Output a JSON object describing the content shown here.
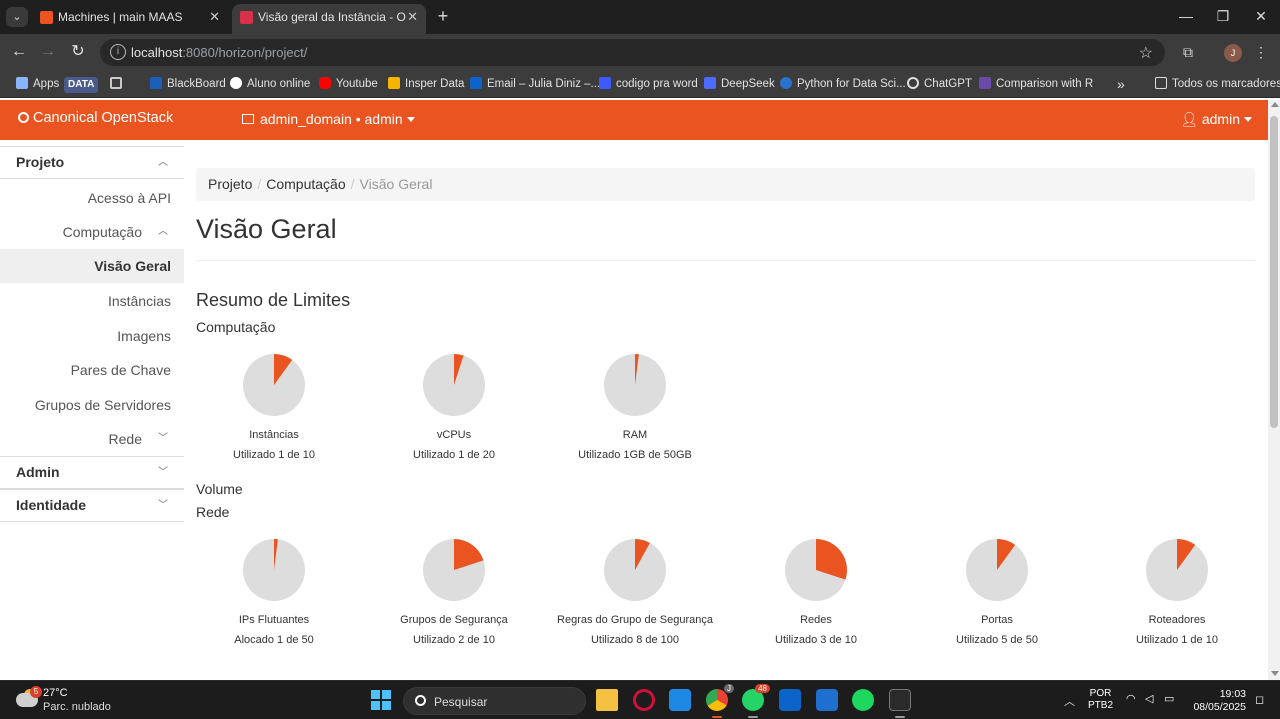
{
  "browser": {
    "tabs": [
      {
        "title": "Machines | main MAAS",
        "icon_color": "#e95420",
        "active": false
      },
      {
        "title": "Visão geral da Instância - Open",
        "icon_color": "#d9304a",
        "active": true
      }
    ],
    "url": {
      "host": "localhost",
      "path": ":8080/horizon/project/"
    },
    "bookmarks": [
      {
        "label": "Apps",
        "icon": "apps-grid-icon",
        "color": "#8ab4f8"
      },
      {
        "label": "DATA",
        "icon": "data-chip-icon",
        "color": "#4a5a8a"
      },
      {
        "label": "",
        "icon": "grid-icon",
        "color": "#cccccc"
      },
      {
        "label": "BlackBoard",
        "icon": "blackboard-icon",
        "color": "#1c5fb8"
      },
      {
        "label": "Aluno online",
        "icon": "aluno-online-icon",
        "color": "#ffffff"
      },
      {
        "label": "Youtube",
        "icon": "youtube-icon",
        "color": "#ff0000"
      },
      {
        "label": "Insper Data",
        "icon": "drive-icon",
        "color": "#f4b400"
      },
      {
        "label": "Email – Julia Diniz –...",
        "icon": "outlook-icon",
        "color": "#0a64c9"
      },
      {
        "label": "codigo pra word",
        "icon": "docs-icon",
        "color": "#3d5afe"
      },
      {
        "label": "DeepSeek",
        "icon": "deepseek-icon",
        "color": "#4d6bfe"
      },
      {
        "label": "Python for Data Sci...",
        "icon": "coursera-icon",
        "color": "#2a73cc"
      },
      {
        "label": "ChatGPT",
        "icon": "chatgpt-icon",
        "color": "#dddddd"
      },
      {
        "label": "Comparison with R",
        "icon": "pandas-icon",
        "color": "#150458"
      }
    ],
    "bookmarks_overflow": "»",
    "all_bookmarks": "Todos os marcadores",
    "profile_initial": "J"
  },
  "header": {
    "brand": "Canonical OpenStack",
    "domain_project": "admin_domain • admin",
    "user": "admin",
    "accent_color": "#e95420"
  },
  "sidebar": {
    "groups": [
      {
        "label": "Projeto",
        "expanded": true
      },
      {
        "label": "Admin",
        "expanded": false
      },
      {
        "label": "Identidade",
        "expanded": false
      }
    ],
    "items": {
      "api_access": "Acesso à API",
      "compute": "Computação",
      "overview": "Visão Geral",
      "instances": "Instâncias",
      "images": "Imagens",
      "key_pairs": "Pares de Chave",
      "server_groups": "Grupos de Servidores",
      "network": "Rede"
    }
  },
  "breadcrumb": [
    "Projeto",
    "Computação",
    "Visão Geral"
  ],
  "page_title": "Visão Geral",
  "limits": {
    "heading": "Resumo de Limites",
    "sections": {
      "compute": "Computação",
      "volume": "Volume",
      "network": "Rede"
    },
    "compute": [
      {
        "name": "Instâncias",
        "usage_text": "Utilizado 1 de 10",
        "used": 1,
        "total": 10
      },
      {
        "name": "vCPUs",
        "usage_text": "Utilizado 1 de 20",
        "used": 1,
        "total": 20
      },
      {
        "name": "RAM",
        "usage_text": "Utilizado 1GB de 50GB",
        "used": 1,
        "total": 50
      }
    ],
    "network": [
      {
        "name": "IPs Flutuantes",
        "usage_text": "Alocado 1 de 50",
        "used": 1,
        "total": 50
      },
      {
        "name": "Grupos de Segurança",
        "usage_text": "Utilizado 2 de 10",
        "used": 2,
        "total": 10
      },
      {
        "name": "Regras do Grupo de Segurança",
        "usage_text": "Utilizado 8 de 100",
        "used": 8,
        "total": 100
      },
      {
        "name": "Redes",
        "usage_text": "Utilizado 3 de 10",
        "used": 3,
        "total": 10
      },
      {
        "name": "Portas",
        "usage_text": "Utilizado 5 de 50",
        "used": 5,
        "total": 50
      },
      {
        "name": "Roteadores",
        "usage_text": "Utilizado 1 de 10",
        "used": 1,
        "total": 10
      }
    ],
    "pie_used_color": "#e95420",
    "pie_free_color": "#dddddd"
  },
  "taskbar": {
    "weather_temp": "27°C",
    "weather_cond": "Parc. nublado",
    "weather_badge": "5",
    "search_placeholder": "Pesquisar",
    "whatsapp_badge": "48",
    "chrome_badge": "J",
    "lang_line1": "POR",
    "lang_line2": "PTB2",
    "time": "19:03",
    "date": "08/05/2025"
  }
}
